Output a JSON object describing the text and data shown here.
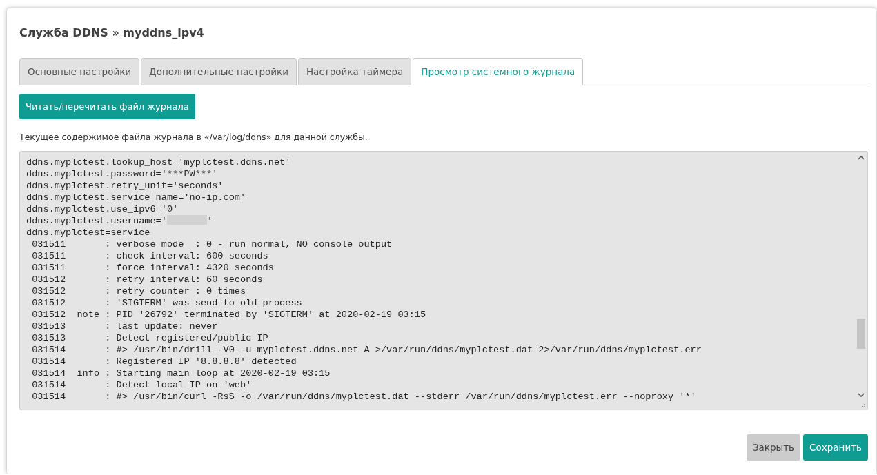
{
  "page": {
    "title": "Служба DDNS » myddns_ipv4"
  },
  "tabs": [
    {
      "label": "Основные настройки",
      "selected": false
    },
    {
      "label": "Дополнительные настройки",
      "selected": false
    },
    {
      "label": "Настройка таймера",
      "selected": false
    },
    {
      "label": "Просмотр системного журнала",
      "selected": true
    }
  ],
  "read_button": "Читать/перечитать файл журнала",
  "description": "Текущее содержимое файла журнала в «/var/log/ddns» для данной службы.",
  "log": [
    {
      "text": "ddns.myplctest.lookup_host='myplctest.ddns.net'"
    },
    {
      "text": "ddns.myplctest.password='***PW***'"
    },
    {
      "text": "ddns.myplctest.retry_unit='seconds'"
    },
    {
      "text": "ddns.myplctest.service_name='no-ip.com'"
    },
    {
      "text": "ddns.myplctest.use_ipv6='0'"
    },
    {
      "text": "ddns.myplctest.username='",
      "redacted": true,
      "text_after": "'"
    },
    {
      "text": "ddns.myplctest=service"
    },
    {
      "text": " 031511       : verbose mode  : 0 - run normal, NO console output"
    },
    {
      "text": " 031511       : check interval: 600 seconds"
    },
    {
      "text": " 031511       : force interval: 4320 seconds"
    },
    {
      "text": " 031512       : retry interval: 60 seconds"
    },
    {
      "text": " 031512       : retry counter : 0 times"
    },
    {
      "text": " 031512       : 'SIGTERM' was send to old process"
    },
    {
      "text": " 031512  note : PID '26792' terminated by 'SIGTERM' at 2020-02-19 03:15"
    },
    {
      "text": " 031513       : last update: never"
    },
    {
      "text": " 031513       : Detect registered/public IP"
    },
    {
      "text": " 031514       : #> /usr/bin/drill -V0 -u myplctest.ddns.net A >/var/run/ddns/myplctest.dat 2>/var/run/ddns/myplctest.err"
    },
    {
      "text": " 031514       : Registered IP '8.8.8.8' detected"
    },
    {
      "text": " 031514  info : Starting main loop at 2020-02-19 03:15"
    },
    {
      "text": " 031514       : Detect local IP on 'web'"
    },
    {
      "text": " 031514       : #> /usr/bin/curl -RsS -o /var/run/ddns/myplctest.dat --stderr /var/run/ddns/myplctest.err --noproxy '*'"
    }
  ],
  "footer_buttons": [
    {
      "label": "Закрыть",
      "kind": "secondary"
    },
    {
      "label": "Сохранить",
      "kind": "primary"
    }
  ]
}
